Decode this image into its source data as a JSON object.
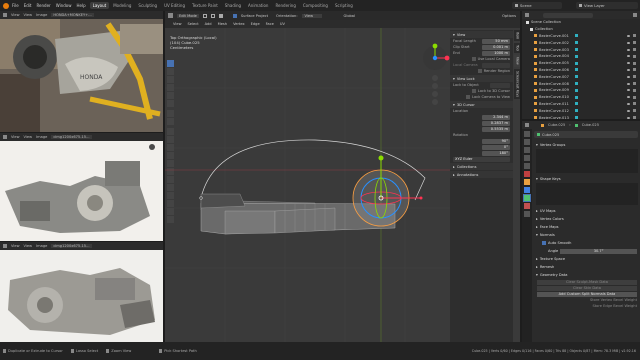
{
  "topbar": {
    "menus": [
      "File",
      "Edit",
      "Render",
      "Window",
      "Help"
    ],
    "workspaces": [
      "Layout",
      "Modeling",
      "Sculpting",
      "UV Editing",
      "Texture Paint",
      "Shading",
      "Animation",
      "Rendering",
      "Compositing",
      "Scripting"
    ],
    "active_workspace": "Layout",
    "scene": "Scene",
    "view_layer": "View Layer"
  },
  "image_editors": [
    {
      "menus": [
        "View",
        "View",
        "Image"
      ],
      "image_name": "HONDA+MONKEY+..."
    },
    {
      "menus": [
        "View",
        "View",
        "Image"
      ],
      "image_name": "cimg1200x675-15..."
    },
    {
      "menus": [
        "View",
        "View",
        "Image"
      ],
      "image_name": "cimg1200x675-15..."
    }
  ],
  "viewport": {
    "mode": "Edit Mode",
    "menus": [
      "View",
      "Select",
      "Add",
      "Mesh",
      "Vertex",
      "Edge",
      "Face",
      "UV"
    ],
    "snap": "Surface Project",
    "orientation_label": "Orientation:",
    "orientation": "View",
    "transform": "Global",
    "options": "Options",
    "view_name": "Top Orthographic (Local)",
    "object_info": "(104) Cube.025",
    "units": "Centimeters",
    "side_tabs": [
      "Item",
      "Tool",
      "View",
      "Screencast Keys"
    ]
  },
  "npanel": {
    "view_header": "View",
    "focal_length_label": "Focal Length",
    "focal_length": "50 mm",
    "clip_start_label": "Clip Start",
    "clip_start": "0.001 m",
    "clip_end_label": "End",
    "clip_end": "1000 m",
    "local_camera_label": "Use Local Camera",
    "local_camera_field": "Local Camera",
    "render_region_label": "Render Region",
    "view_lock_header": "View Lock",
    "lock_object_label": "Lock to Object",
    "lock_3d_cursor_label": "Lock to 3D Cursor",
    "lock_camera_label": "Lock Camera to View",
    "cursor_header": "3D Cursor",
    "location_label": "Location",
    "location": [
      "2.344 m",
      "0.2837 m",
      "0.5535 m"
    ],
    "rotation_label": "Rotation",
    "rotation": [
      "90°",
      "0°",
      "180°"
    ],
    "rotation_mode": "XYZ Euler",
    "collections_header": "Collections",
    "annotations_header": "Annotations"
  },
  "outliner": {
    "root": "Scene Collection",
    "collection": "Collection",
    "items": [
      "BezierCurve.001",
      "BezierCurve.002",
      "BezierCurve.003",
      "BezierCurve.004",
      "BezierCurve.005",
      "BezierCurve.006",
      "BezierCurve.007",
      "BezierCurve.008",
      "BezierCurve.009",
      "BezierCurve.010",
      "BezierCurve.011",
      "BezierCurve.012",
      "BezierCurve.013"
    ]
  },
  "properties": {
    "breadcrumb_object": "Cube.025",
    "breadcrumb_mesh": "Cube.025",
    "mesh_name": "Cube.025",
    "sections": [
      "Vertex Groups",
      "Shape Keys",
      "UV Maps",
      "Vertex Colors",
      "Face Maps",
      "Normals"
    ],
    "auto_smooth_label": "Auto Smooth",
    "angle_label": "Angle",
    "angle_value": "30.7°",
    "sections2": [
      "Texture Space",
      "Remesh",
      "Geometry Data"
    ],
    "clear_sculpt_mask": "Clear Sculpt-Mask Data",
    "clear_skin": "Clear Skin Data",
    "add_custom_split_normals": "Add Custom Split Normals Data",
    "store_vertex_bevel": "Store Vertex Bevel Weight",
    "store_edge_bevel": "Store Edge Bevel Weight"
  },
  "statusbar": {
    "left_hint": "Duplicate or Extrude to Cursor",
    "mid_hint": "Lasso Select",
    "zoom_hint": "Zoom View",
    "pick_hint": "Pick Shortest Path",
    "stats": "Cube.025 | Verts 0/60 | Edges 0/116 | Faces 0/60 | Tris 88 | Objects 0/87 | Mem: 78.3 MiB | v2.92.16"
  },
  "colors": {
    "accent": "#4772b3",
    "selection_orange": "#ffa040",
    "x_axis": "#ff3352",
    "y_axis": "#8bdc00",
    "z_axis": "#2890ff"
  }
}
